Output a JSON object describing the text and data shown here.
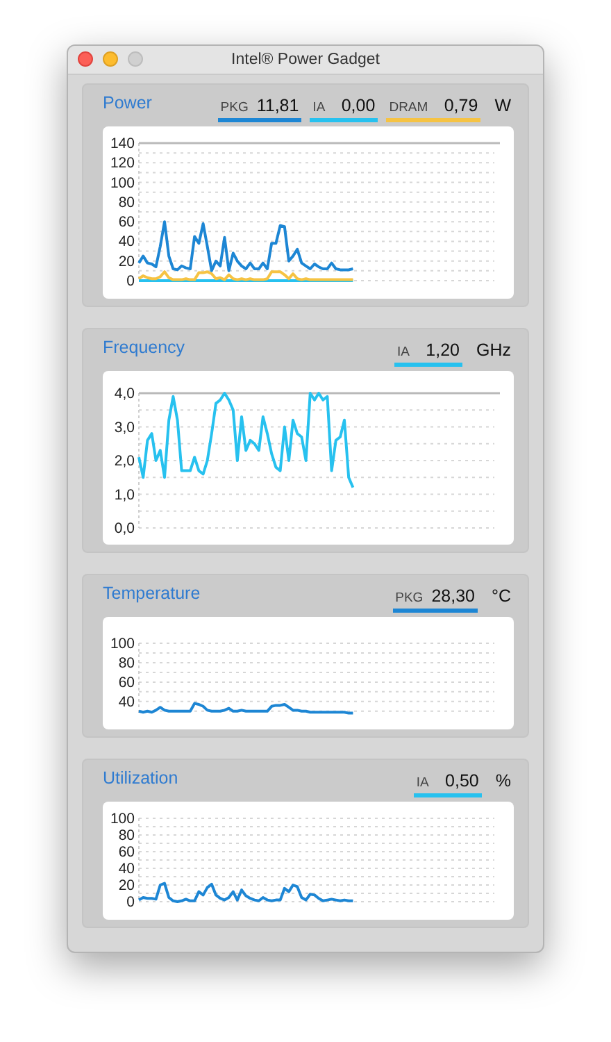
{
  "window": {
    "title": "Intel® Power Gadget"
  },
  "panels": [
    {
      "title": "Power",
      "unit": "W",
      "legend": [
        {
          "value": "11,81",
          "color": "#1d86d4"
        },
        {
          "value": "0,00",
          "color": "#27c1ef"
        },
        {
          "value": "0,79",
          "color": "#f6c343"
        }
      ],
      "chart_data": {
        "type": "line",
        "grid": true,
        "ylim": [
          0,
          140
        ],
        "yticks": [
          0,
          20,
          40,
          60,
          80,
          100,
          120,
          140
        ],
        "series": [
          {
            "name": "PKG",
            "color": "#1d86d4",
            "values": [
              18,
              25,
              18,
              17,
              14,
              35,
              60,
              25,
              12,
              11,
              15,
              13,
              12,
              45,
              38,
              58,
              35,
              10,
              20,
              15,
              44,
              10,
              28,
              20,
              15,
              12,
              18,
              12,
              12,
              18,
              12,
              38,
              38,
              56,
              55,
              20,
              25,
              32,
              18,
              15,
              12,
              17,
              14,
              12,
              12,
              18,
              12,
              11,
              11,
              11,
              12
            ]
          },
          {
            "name": "IA",
            "color": "#27c1ef",
            "values": [
              0,
              0,
              0,
              0,
              0,
              0,
              0,
              0,
              0,
              0,
              0,
              0,
              0,
              0,
              0,
              0,
              0,
              0,
              0,
              0,
              0,
              0,
              0,
              0,
              0,
              0,
              0,
              0,
              0,
              0,
              0,
              0,
              0,
              0,
              0,
              0,
              0,
              0,
              0,
              0,
              0,
              0,
              0,
              0,
              0,
              0,
              0,
              0,
              0,
              0,
              0
            ]
          },
          {
            "name": "DRAM",
            "color": "#f6c343",
            "values": [
              2,
              5,
              3,
              2,
              2,
              4,
              9,
              3,
              1,
              1,
              1,
              2,
              1,
              1,
              8,
              8,
              9,
              7,
              2,
              3,
              1,
              6,
              2,
              1,
              2,
              1,
              2,
              1,
              1,
              1,
              2,
              9,
              9,
              9,
              6,
              2,
              7,
              2,
              1,
              2,
              1,
              1,
              1,
              1,
              1,
              1,
              1,
              1,
              1,
              1,
              1
            ]
          }
        ]
      }
    },
    {
      "title": "Frequency",
      "unit": "GHz",
      "legend": [
        {
          "value": "1,20",
          "color": "#27c1ef"
        }
      ],
      "chart_data": {
        "type": "line",
        "grid": true,
        "ylim": [
          0,
          4
        ],
        "yticks": [
          {
            "value": 0,
            "label": "0,0"
          },
          {
            "value": 1,
            "label": "1,0"
          },
          {
            "value": 2,
            "label": "2,0"
          },
          {
            "value": 3,
            "label": "3,0"
          },
          {
            "value": 4,
            "label": "4,0"
          }
        ],
        "series": [
          {
            "name": "IA",
            "color": "#27c1ef",
            "values": [
              2.1,
              1.5,
              2.6,
              2.8,
              2.0,
              2.3,
              1.5,
              3.2,
              3.9,
              3.2,
              1.7,
              1.7,
              1.7,
              2.1,
              1.7,
              1.6,
              2.0,
              2.8,
              3.7,
              3.8,
              4.0,
              3.8,
              3.5,
              2.0,
              3.3,
              2.3,
              2.6,
              2.5,
              2.3,
              3.3,
              2.8,
              2.2,
              1.8,
              1.7,
              3.0,
              2.0,
              3.2,
              2.8,
              2.7,
              2.0,
              4.0,
              3.8,
              4.0,
              3.8,
              3.9,
              1.7,
              2.6,
              2.7,
              3.2,
              1.5,
              1.2
            ]
          }
        ]
      }
    },
    {
      "title": "Temperature",
      "unit": "°C",
      "legend": [
        {
          "value": "28,30",
          "color": "#1d86d4"
        }
      ],
      "chart_data": {
        "type": "line",
        "grid": true,
        "ylim": [
          27,
          100
        ],
        "yticks": [
          40,
          60,
          80,
          100
        ],
        "series": [
          {
            "name": "PKG",
            "color": "#1d86d4",
            "values": [
              30,
              29,
              30,
              29,
              31,
              34,
              31,
              30,
              30,
              30,
              30,
              30,
              30,
              38,
              37,
              35,
              31,
              30,
              30,
              30,
              31,
              33,
              30,
              30,
              31,
              30,
              30,
              30,
              30,
              30,
              30,
              35,
              36,
              36,
              37,
              34,
              31,
              31,
              30,
              30,
              29,
              29,
              29,
              29,
              29,
              29,
              29,
              29,
              29,
              28,
              28
            ]
          }
        ]
      }
    },
    {
      "title": "Utilization",
      "unit": "%",
      "legend": [
        {
          "value": "0,50",
          "color": "#27c1ef"
        }
      ],
      "chart_data": {
        "type": "line",
        "grid": true,
        "ylim": [
          0,
          100
        ],
        "yticks": [
          0,
          20,
          40,
          60,
          80,
          100
        ],
        "series": [
          {
            "name": "IA",
            "color": "#1d86d4",
            "values": [
              2,
              5,
              4,
              4,
              3,
              20,
              22,
              5,
              1,
              0,
              1,
              3,
              1,
              1,
              12,
              8,
              17,
              21,
              8,
              4,
              2,
              5,
              12,
              2,
              14,
              7,
              4,
              2,
              1,
              5,
              2,
              1,
              2,
              2,
              16,
              12,
              20,
              18,
              5,
              2,
              9,
              8,
              4,
              1,
              2,
              3,
              2,
              1,
              2,
              1,
              1
            ]
          }
        ]
      }
    }
  ]
}
